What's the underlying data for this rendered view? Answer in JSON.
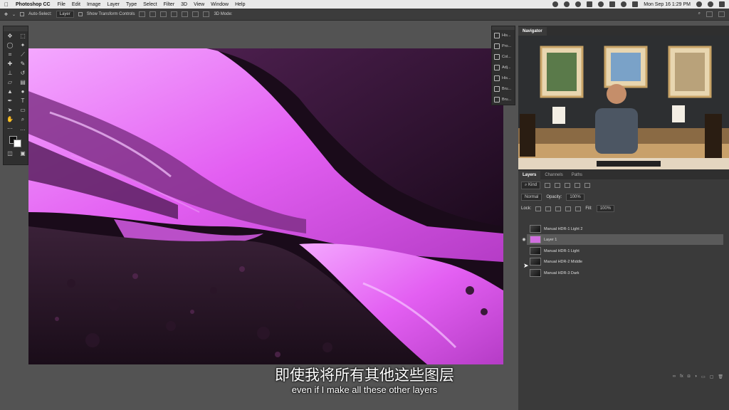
{
  "menubar": {
    "app_name": "Photoshop CC",
    "items": [
      "File",
      "Edit",
      "Image",
      "Layer",
      "Type",
      "Select",
      "Filter",
      "3D",
      "View",
      "Window",
      "Help"
    ],
    "datetime": "Mon Sep 16  1:29 PM"
  },
  "options": {
    "auto_select_label": "Auto-Select:",
    "auto_select_value": "Layer",
    "transform_label": "Show Transform Controls",
    "mode_label": "3D Mode:"
  },
  "minipanels": [
    "His...",
    "Pro...",
    "Col...",
    "Adj...",
    "His...",
    "Bru...",
    "Bru..."
  ],
  "navigator": {
    "tab": "Navigator"
  },
  "layers_panel": {
    "tabs": [
      "Layers",
      "Channels",
      "Paths"
    ],
    "kind_label": "Kind",
    "blend_mode": "Normal",
    "opacity_label": "Opacity:",
    "opacity_value": "100%",
    "lock_label": "Lock:",
    "fill_label": "Fill:",
    "fill_value": "100%",
    "layers": [
      {
        "name": "Manual HDR-1 Light 2",
        "visible": false,
        "selected": false
      },
      {
        "name": "Layer 1",
        "visible": true,
        "selected": true
      },
      {
        "name": "Manual HDR-1 Light",
        "visible": false,
        "selected": false
      },
      {
        "name": "Manual HDR-2 Middle",
        "visible": false,
        "selected": false
      },
      {
        "name": "Manual HDR-3 Dark",
        "visible": false,
        "selected": false
      }
    ],
    "footer": [
      "∞",
      "fx",
      "◘",
      "◑",
      "▭",
      "▢",
      "🗑"
    ]
  },
  "subtitles": {
    "chinese": "即使我将所有其他这些图层",
    "english": "even if I make all these other layers"
  },
  "colors": {
    "accent_pink": "#e06cf0",
    "panel": "#3a3a3a",
    "menubar": "#e9e9e9"
  }
}
